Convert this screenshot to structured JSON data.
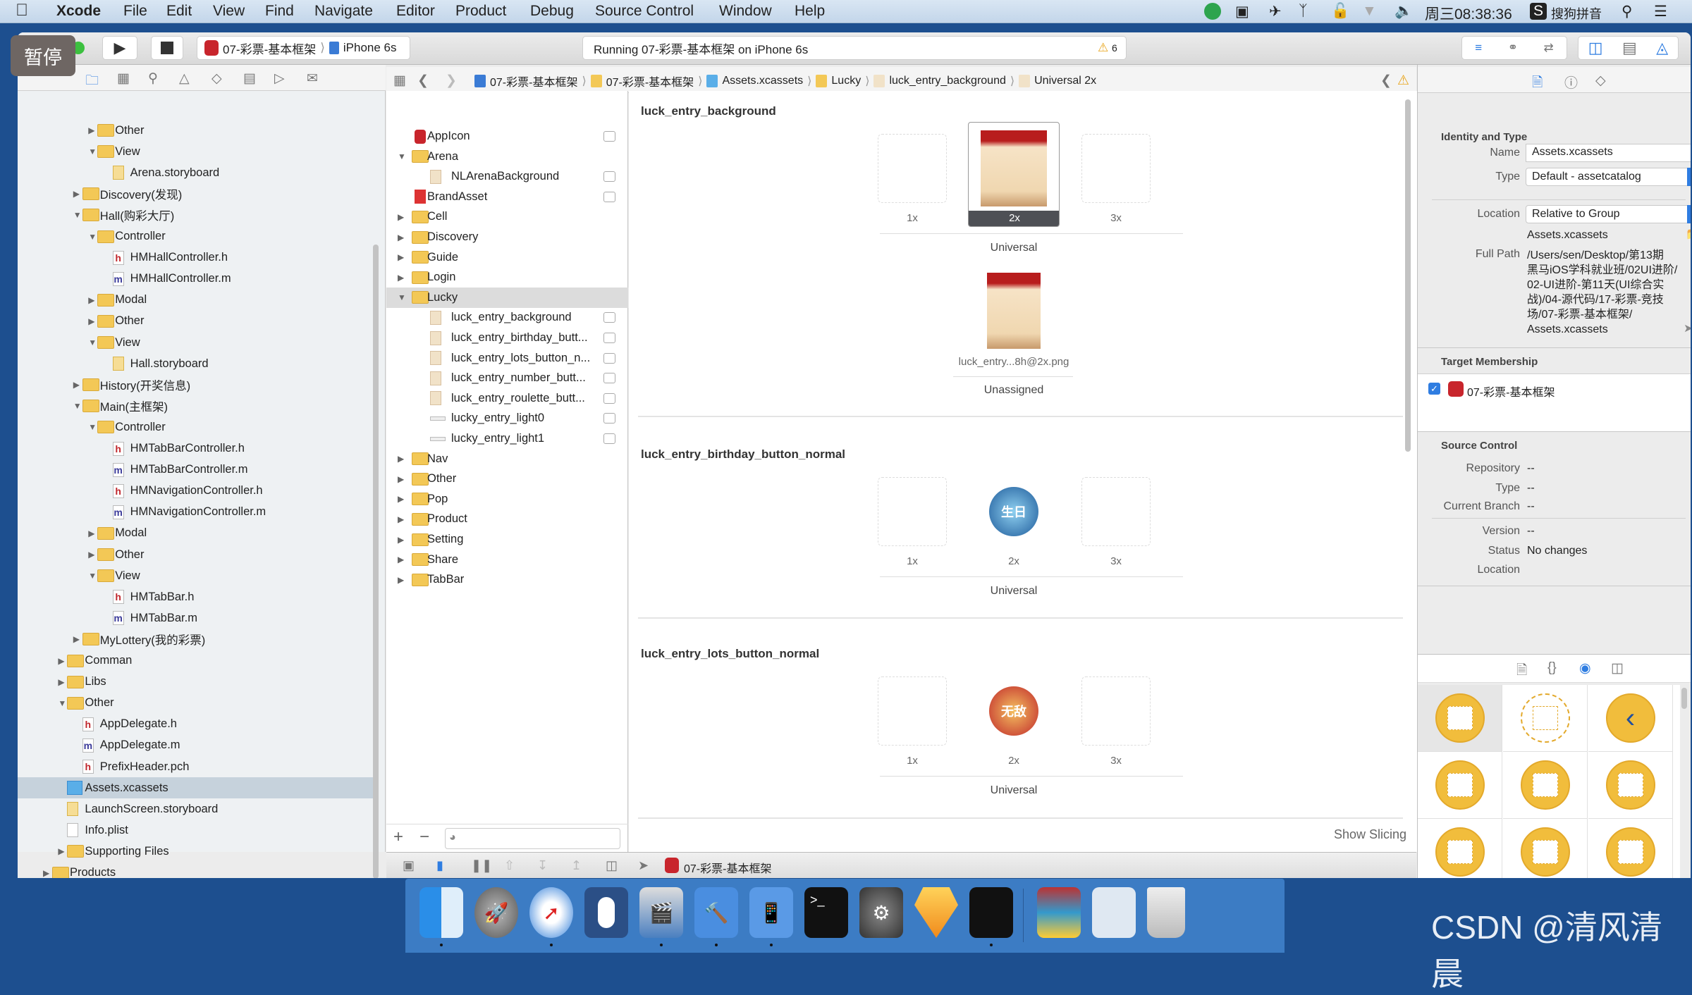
{
  "menubar": {
    "app": "Xcode",
    "items": [
      "File",
      "Edit",
      "View",
      "Find",
      "Navigate",
      "Editor",
      "Product",
      "Debug",
      "Source Control",
      "Window",
      "Help"
    ],
    "clock": "周三08:38:36",
    "input_method": "搜狗拼音"
  },
  "overlay": {
    "pause_label": "暂停"
  },
  "toolbar": {
    "scheme": "07-彩票-基本框架",
    "device": "iPhone 6s",
    "activity": "Running 07-彩票-基本框架 on iPhone 6s",
    "warning_count": "6"
  },
  "jumpbar": {
    "crumbs": [
      "07-彩票-基本框架",
      "07-彩票-基本框架",
      "Assets.xcassets",
      "Lucky",
      "luck_entry_background",
      "Universal 2x"
    ]
  },
  "navigator": {
    "items": [
      {
        "label": "Other",
        "level": 3,
        "arrow": "closed",
        "icon": "folder"
      },
      {
        "label": "View",
        "level": 3,
        "arrow": "open",
        "icon": "folder"
      },
      {
        "label": "Arena.storyboard",
        "level": 4,
        "arrow": "none",
        "icon": "storyboard"
      },
      {
        "label": "Discovery(发现)",
        "level": 2,
        "arrow": "closed",
        "icon": "folder"
      },
      {
        "label": "Hall(购彩大厅)",
        "level": 2,
        "arrow": "open",
        "icon": "folder"
      },
      {
        "label": "Controller",
        "level": 3,
        "arrow": "open",
        "icon": "folder"
      },
      {
        "label": "HMHallController.h",
        "level": 4,
        "arrow": "none",
        "icon": "h"
      },
      {
        "label": "HMHallController.m",
        "level": 4,
        "arrow": "none",
        "icon": "m"
      },
      {
        "label": "Modal",
        "level": 3,
        "arrow": "closed",
        "icon": "folder"
      },
      {
        "label": "Other",
        "level": 3,
        "arrow": "closed",
        "icon": "folder"
      },
      {
        "label": "View",
        "level": 3,
        "arrow": "open",
        "icon": "folder"
      },
      {
        "label": "Hall.storyboard",
        "level": 4,
        "arrow": "none",
        "icon": "storyboard"
      },
      {
        "label": "History(开奖信息)",
        "level": 2,
        "arrow": "closed",
        "icon": "folder"
      },
      {
        "label": "Main(主框架)",
        "level": 2,
        "arrow": "open",
        "icon": "folder"
      },
      {
        "label": "Controller",
        "level": 3,
        "arrow": "open",
        "icon": "folder"
      },
      {
        "label": "HMTabBarController.h",
        "level": 4,
        "arrow": "none",
        "icon": "h"
      },
      {
        "label": "HMTabBarController.m",
        "level": 4,
        "arrow": "none",
        "icon": "m"
      },
      {
        "label": "HMNavigationController.h",
        "level": 4,
        "arrow": "none",
        "icon": "h"
      },
      {
        "label": "HMNavigationController.m",
        "level": 4,
        "arrow": "none",
        "icon": "m"
      },
      {
        "label": "Modal",
        "level": 3,
        "arrow": "closed",
        "icon": "folder"
      },
      {
        "label": "Other",
        "level": 3,
        "arrow": "closed",
        "icon": "folder"
      },
      {
        "label": "View",
        "level": 3,
        "arrow": "open",
        "icon": "folder"
      },
      {
        "label": "HMTabBar.h",
        "level": 4,
        "arrow": "none",
        "icon": "h"
      },
      {
        "label": "HMTabBar.m",
        "level": 4,
        "arrow": "none",
        "icon": "m"
      },
      {
        "label": "MyLottery(我的彩票)",
        "level": 2,
        "arrow": "closed",
        "icon": "folder"
      },
      {
        "label": "Comman",
        "level": 1,
        "arrow": "closed",
        "icon": "folder"
      },
      {
        "label": "Libs",
        "level": 1,
        "arrow": "closed",
        "icon": "folder"
      },
      {
        "label": "Other",
        "level": 1,
        "arrow": "open",
        "icon": "folder"
      },
      {
        "label": "AppDelegate.h",
        "level": 2,
        "arrow": "none",
        "icon": "h"
      },
      {
        "label": "AppDelegate.m",
        "level": 2,
        "arrow": "none",
        "icon": "m"
      },
      {
        "label": "PrefixHeader.pch",
        "level": 2,
        "arrow": "none",
        "icon": "h"
      },
      {
        "label": "Assets.xcassets",
        "level": 1,
        "arrow": "none",
        "icon": "xcassets",
        "selected": true
      },
      {
        "label": "LaunchScreen.storyboard",
        "level": 1,
        "arrow": "none",
        "icon": "storyboard"
      },
      {
        "label": "Info.plist",
        "level": 1,
        "arrow": "none",
        "icon": "plist"
      },
      {
        "label": "Supporting Files",
        "level": 1,
        "arrow": "closed",
        "icon": "folder"
      },
      {
        "label": "Products",
        "level": 0,
        "arrow": "closed",
        "icon": "folder"
      }
    ]
  },
  "asset_list": {
    "items": [
      {
        "label": "AppIcon",
        "level": 0,
        "arrow": "none",
        "icon": "appicon"
      },
      {
        "label": "Arena",
        "level": 0,
        "arrow": "open",
        "icon": "folder"
      },
      {
        "label": "NLArenaBackground",
        "level": 1,
        "arrow": "none",
        "icon": "image"
      },
      {
        "label": "BrandAsset",
        "level": 0,
        "arrow": "none",
        "icon": "brand"
      },
      {
        "label": "Cell",
        "level": 0,
        "arrow": "closed",
        "icon": "folder"
      },
      {
        "label": "Discovery",
        "level": 0,
        "arrow": "closed",
        "icon": "folder"
      },
      {
        "label": "Guide",
        "level": 0,
        "arrow": "closed",
        "icon": "folder"
      },
      {
        "label": "Login",
        "level": 0,
        "arrow": "closed",
        "icon": "folder"
      },
      {
        "label": "Lucky",
        "level": 0,
        "arrow": "open",
        "icon": "folder",
        "selected": true
      },
      {
        "label": "luck_entry_background",
        "level": 1,
        "arrow": "none",
        "icon": "image"
      },
      {
        "label": "luck_entry_birthday_butt...",
        "level": 1,
        "arrow": "none",
        "icon": "image"
      },
      {
        "label": "luck_entry_lots_button_n...",
        "level": 1,
        "arrow": "none",
        "icon": "image"
      },
      {
        "label": "luck_entry_number_butt...",
        "level": 1,
        "arrow": "none",
        "icon": "image"
      },
      {
        "label": "luck_entry_roulette_butt...",
        "level": 1,
        "arrow": "none",
        "icon": "image"
      },
      {
        "label": "lucky_entry_light0",
        "level": 1,
        "arrow": "none",
        "icon": "light"
      },
      {
        "label": "lucky_entry_light1",
        "level": 1,
        "arrow": "none",
        "icon": "light"
      },
      {
        "label": "Nav",
        "level": 0,
        "arrow": "closed",
        "icon": "folder"
      },
      {
        "label": "Other",
        "level": 0,
        "arrow": "closed",
        "icon": "folder"
      },
      {
        "label": "Pop",
        "level": 0,
        "arrow": "closed",
        "icon": "folder"
      },
      {
        "label": "Product",
        "level": 0,
        "arrow": "closed",
        "icon": "folder"
      },
      {
        "label": "Setting",
        "level": 0,
        "arrow": "closed",
        "icon": "folder"
      },
      {
        "label": "Share",
        "level": 0,
        "arrow": "closed",
        "icon": "folder"
      },
      {
        "label": "TabBar",
        "level": 0,
        "arrow": "closed",
        "icon": "folder"
      }
    ]
  },
  "editor": {
    "sections": [
      {
        "title": "luck_entry_background",
        "slots": [
          "1x",
          "2x",
          "3x"
        ],
        "idiom": "Universal",
        "filled": "2x",
        "selected": true,
        "image": "curtain",
        "unassigned": {
          "file": "luck_entry...8h@2x.png",
          "label": "Unassigned"
        }
      },
      {
        "title": "luck_entry_birthday_button_normal",
        "slots": [
          "1x",
          "2x",
          "3x"
        ],
        "idiom": "Universal",
        "filled": "2x",
        "image": "birthday",
        "image_text": "生日"
      },
      {
        "title": "luck_entry_lots_button_normal",
        "slots": [
          "1x",
          "2x",
          "3x"
        ],
        "idiom": "Universal",
        "filled": "2x",
        "image": "lots",
        "image_text": "无敌"
      }
    ],
    "show_slicing": "Show Slicing"
  },
  "inspector": {
    "identity": {
      "header": "Identity and Type",
      "name_label": "Name",
      "name": "Assets.xcassets",
      "type_label": "Type",
      "type": "Default - assetcatalog",
      "location_label": "Location",
      "location": "Relative to Group",
      "relative_path": "Assets.xcassets",
      "full_path_label": "Full Path",
      "full_path_lines": [
        "/Users/sen/Desktop/第13期",
        "黑马iOS学科就业班/02UI进阶/",
        "02-UI进阶-第11天(UI综合实",
        "战)/04-源代码/17-彩票-竞技",
        "场/07-彩票-基本框架/",
        "Assets.xcassets"
      ]
    },
    "target": {
      "header": "Target Membership",
      "name": "07-彩票-基本框架",
      "checked": true
    },
    "source_control": {
      "header": "Source Control",
      "repository_label": "Repository",
      "repository": "--",
      "type_label": "Type",
      "type": "--",
      "branch_label": "Current Branch",
      "branch": "--",
      "version_label": "Version",
      "version": "--",
      "status_label": "Status",
      "status": "No changes",
      "location_label": "Location"
    }
  },
  "debugbar": {
    "target": "07-彩票-基本框架"
  },
  "watermark": "CSDN @清风清晨",
  "colors": {
    "accent": "#2f7de1",
    "folder": "#f3c856",
    "library_object": "#f1bd3c",
    "dock": "#3c7cc4"
  }
}
